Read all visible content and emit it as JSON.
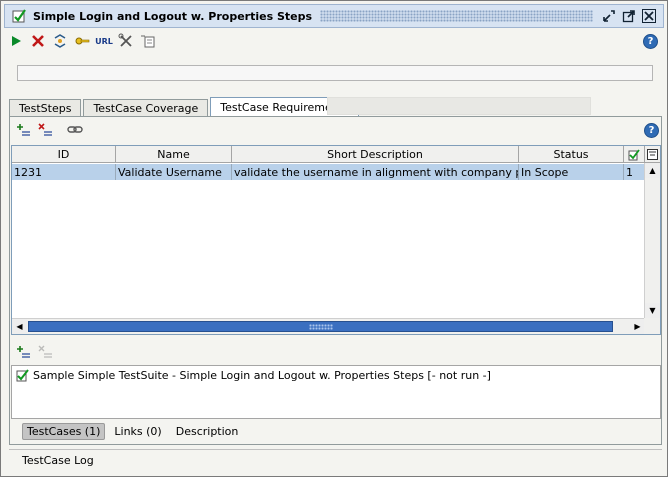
{
  "window": {
    "title": "Simple Login and Logout w. Properties Steps"
  },
  "toolbar": {
    "url_label": "URL",
    "help_label": "?"
  },
  "tabs": [
    {
      "label": "TestSteps"
    },
    {
      "label": "TestCase Coverage"
    },
    {
      "label": "TestCase Requirements",
      "active": true
    }
  ],
  "requirements_table": {
    "columns": [
      "ID",
      "Name",
      "Short Description",
      "Status"
    ],
    "rows": [
      {
        "id": "1231",
        "name": "Validate Username",
        "short_description": "validate the username in alignment with company policy",
        "status": "In Scope",
        "extra": "1",
        "selected": true
      }
    ]
  },
  "association": {
    "item_label": "Sample Simple TestSuite - Simple Login and Logout w. Properties Steps [- not run -]"
  },
  "subtabs": [
    {
      "label": "TestCases (1)",
      "active": true
    },
    {
      "label": "Links (0)"
    },
    {
      "label": "Description"
    }
  ],
  "statusbar": {
    "label": "TestCase Log"
  },
  "colors": {
    "selection": "#b9d1ea",
    "scroll_thumb": "#3a6fc0",
    "run_green": "#0a8a2a",
    "cancel_red": "#c01818"
  }
}
